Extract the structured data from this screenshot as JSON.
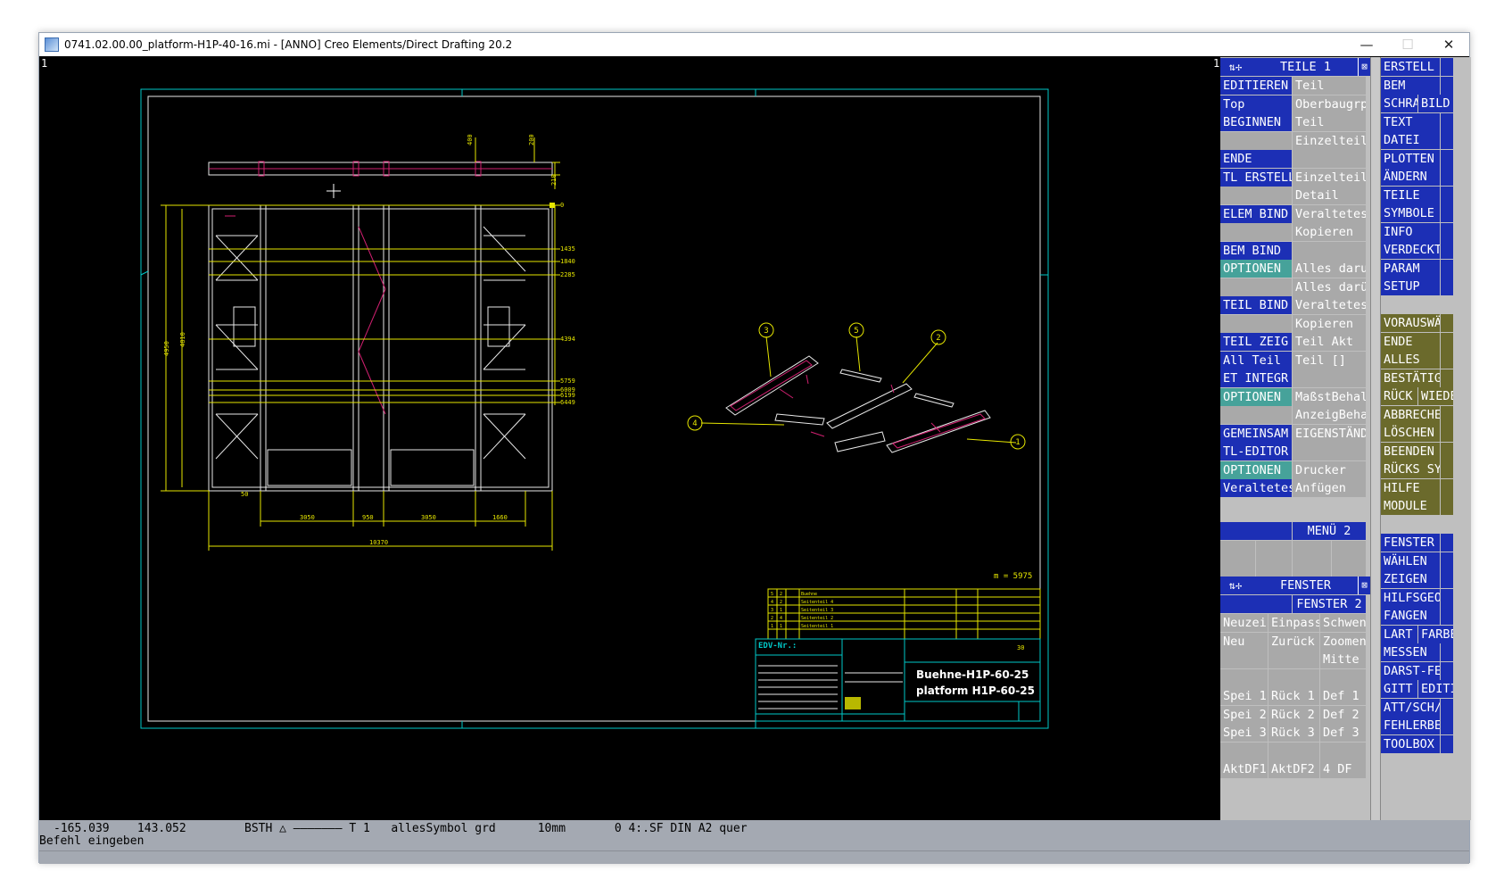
{
  "window": {
    "title": "0741.02.00.00_platform-H1P-40-16.mi - [ANNO]  Creo Elements/Direct Drafting 20.2",
    "controls": [
      "—",
      "☐",
      "✕"
    ]
  },
  "canvas": {
    "corner_left": "1",
    "corner_right": "1",
    "dimensions": {
      "top_400": "400",
      "top_200": "200",
      "top_210": "210",
      "zero": "0",
      "d1435": "1435",
      "d1840": "1840",
      "d2285": "2285",
      "d4394": "4394",
      "d5759": "5759",
      "d6009": "6009",
      "d6199": "6199",
      "d6449": "6449",
      "left_4950": "4950",
      "left_4810": "4810",
      "bottom_50": "50",
      "b3050a": "3050",
      "b950": "950",
      "b3050b": "3050",
      "b1660": "1660",
      "b10370": "10370"
    },
    "mass": "m = 5975",
    "balloons": [
      "3",
      "5",
      "2",
      "4",
      "1"
    ],
    "title_block": {
      "edv": "EDV-Nr.:",
      "title_line1": "Buehne-H1P-60-25",
      "title_line2": "platform H1P-60-25",
      "sheet": "30",
      "items": [
        {
          "pos": "5",
          "qty": "2",
          "name": "Buehne"
        },
        {
          "pos": "4",
          "qty": "2",
          "name": "Seitenteil 4"
        },
        {
          "pos": "3",
          "qty": "1",
          "name": "Seitenteil 3"
        },
        {
          "pos": "2",
          "qty": "4",
          "name": "Seitenteil 2"
        },
        {
          "pos": "1",
          "qty": "1",
          "name": "Seitenteil 1"
        }
      ]
    }
  },
  "colors": {
    "frame": "#00c8c8",
    "geometry": "#e8e8e8",
    "dimension": "#e6e600",
    "accent": "#d02070",
    "menu_blue": "#1c2fb5",
    "menu_gray": "#a9a9a9",
    "menu_teal": "#46a29a",
    "menu_olive": "#6b6a2c"
  },
  "menu_left": {
    "header": "TEILE 1",
    "rows": [
      [
        "EDITIEREN",
        "Teil"
      ],
      [
        "Top",
        "Oberbaugrp"
      ],
      [
        "BEGINNEN",
        "Teil"
      ],
      [
        "",
        "Einzelteil"
      ],
      [
        "ENDE",
        ""
      ],
      [
        "TL ERSTELL",
        "Einzelteil"
      ],
      [
        "",
        "Detail"
      ],
      [
        "ELEM BIND",
        "Veraltetes"
      ],
      [
        "",
        "Kopieren"
      ],
      [
        "BEM BIND",
        ""
      ],
      [
        "OPTIONEN",
        "Alles daru"
      ],
      [
        "",
        "Alles darü"
      ],
      [
        "TEIL BIND",
        "Veraltetes"
      ],
      [
        "",
        "Kopieren"
      ],
      [
        "TEIL ZEIG",
        "Teil Akt"
      ],
      [
        "All Teil",
        "Teil []"
      ],
      [
        "ET INTEGR",
        ""
      ],
      [
        "OPTIONEN",
        "MaßstBehal"
      ],
      [
        "",
        "AnzeigBeha"
      ],
      [
        "GEMEINSAM",
        "EIGENSTÄND"
      ],
      [
        "TL-EDITOR",
        ""
      ],
      [
        "OPTIONEN",
        "Drucker"
      ],
      [
        "Veraltetes",
        "Anfügen"
      ]
    ],
    "menu2": "MENÜ 2",
    "fenster_header": "FENSTER",
    "fenster2": "FENSTER 2",
    "fenster_rows": [
      [
        "Neuzei",
        "Einpass",
        "Schwen"
      ],
      [
        "Neu",
        "Zurück",
        "Zoomen"
      ],
      [
        "",
        "",
        "Mitte"
      ],
      [
        "",
        "",
        ""
      ],
      [
        "Spei 1",
        "Rück 1",
        "Def 1"
      ],
      [
        "Spei 2",
        "Rück 2",
        "Def 2"
      ],
      [
        "Spei 3",
        "Rück 3",
        "Def 3"
      ],
      [
        "",
        "",
        ""
      ],
      [
        "AktDF1",
        "AktDF2",
        "4 DF"
      ]
    ]
  },
  "menu_right": {
    "top": [
      "ERSTELL",
      "BEM",
      "SCHRA|BILD",
      "TEXT",
      "DATEI",
      "PLOTTEN",
      "ÄNDERN",
      "TEILE",
      "SYMBOLE",
      "INFO",
      "VERDECKT",
      "PARAM",
      "SETUP"
    ],
    "mid": [
      "VORAUSWÄHL",
      "ENDE",
      "ALLES",
      "BESTÄTIGEN",
      "RÜCK|WIEDE",
      "ABBRECHEN",
      "LÖSCHEN",
      "BEENDEN",
      "RÜCKS SYS",
      "HILFE",
      "MODULE"
    ],
    "bottom": [
      "FENSTER",
      "WÄHLEN",
      "ZEIGEN",
      "HILFSGEO",
      "FANGEN",
      "LART|FARBE",
      "MESSEN",
      "DARST-FENS",
      "GITT|EDITI",
      "ATT/SCH/NR",
      "FEHLERBEHE",
      "TOOLBOX"
    ]
  },
  "status": {
    "coords": "-165.039    143.052",
    "info": "BSTH △ ——————— T 1   allesSymbol grd      10mm       0 4:.SF DIN A2 quer",
    "prompt": "Befehl eingeben"
  }
}
